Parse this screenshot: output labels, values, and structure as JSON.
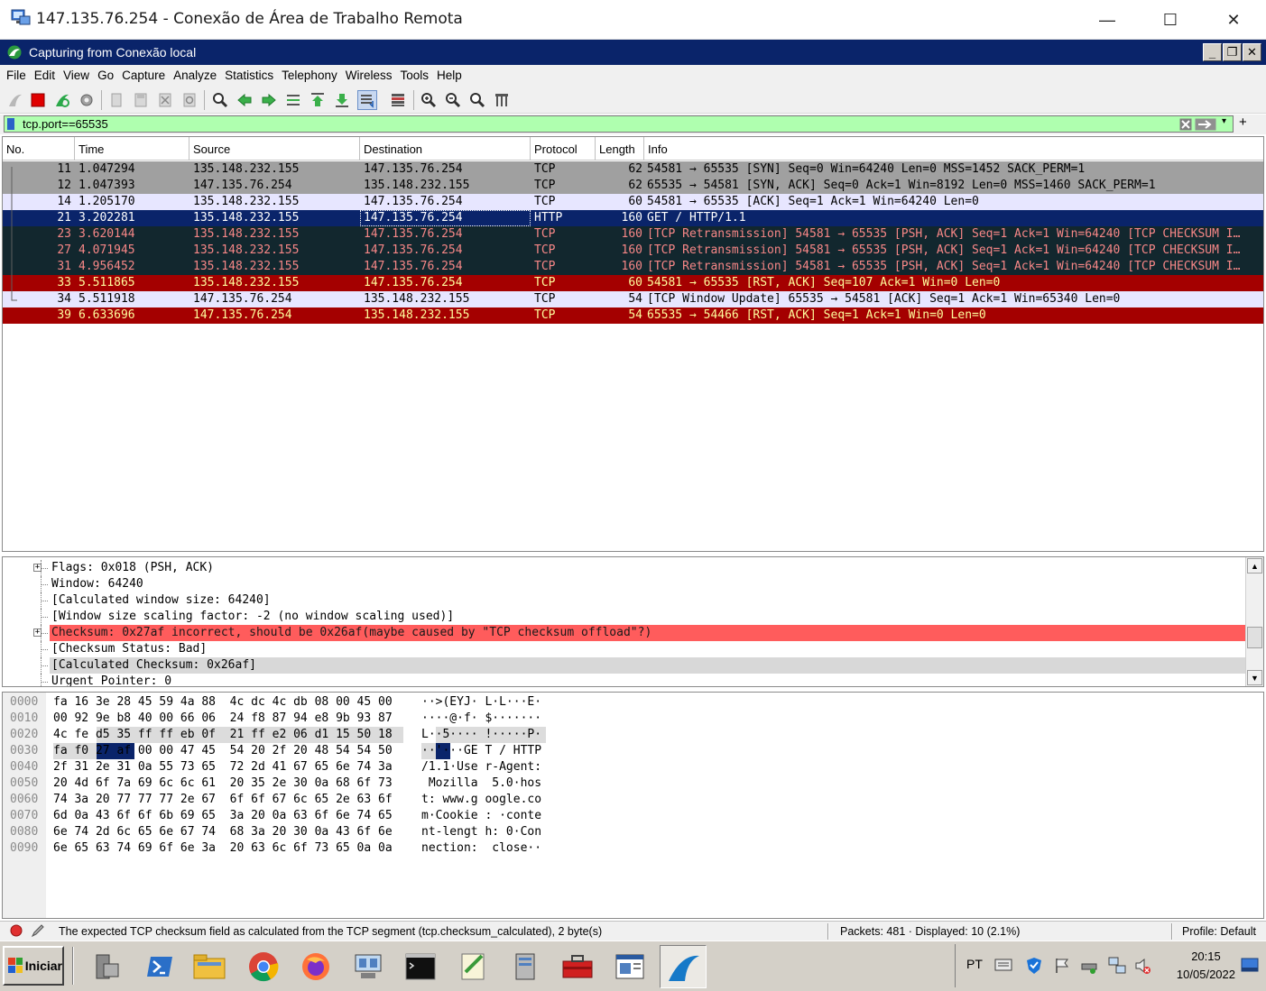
{
  "rdp": {
    "title": "147.135.76.254 - Conexão de Área de Trabalho Remota",
    "minimize": "—",
    "maximize": "☐",
    "close": "✕"
  },
  "wireshark": {
    "title": "Capturing from Conexão local"
  },
  "menu": [
    "File",
    "Edit",
    "View",
    "Go",
    "Capture",
    "Analyze",
    "Statistics",
    "Telephony",
    "Wireless",
    "Tools",
    "Help"
  ],
  "filter": {
    "value": "tcp.port==65535",
    "bg_color": "#afffaf"
  },
  "columns": [
    "No.",
    "Time",
    "Source",
    "Destination",
    "Protocol",
    "Length",
    "Info"
  ],
  "packets": [
    {
      "no": "11",
      "time": "1.047294",
      "src": "135.148.232.155",
      "dst": "147.135.76.254",
      "proto": "TCP",
      "len": "62",
      "info": "54581 → 65535 [SYN] Seq=0 Win=64240 Len=0 MSS=1452 SACK_PERM=1",
      "style": "syn"
    },
    {
      "no": "12",
      "time": "1.047393",
      "src": "147.135.76.254",
      "dst": "135.148.232.155",
      "proto": "TCP",
      "len": "62",
      "info": "65535 → 54581 [SYN, ACK] Seq=0 Ack=1 Win=8192 Len=0 MSS=1460 SACK_PERM=1",
      "style": "syn"
    },
    {
      "no": "14",
      "time": "1.205170",
      "src": "135.148.232.155",
      "dst": "147.135.76.254",
      "proto": "TCP",
      "len": "60",
      "info": "54581 → 65535 [ACK] Seq=1 Ack=1 Win=64240 Len=0",
      "style": "tcp"
    },
    {
      "no": "21",
      "time": "3.202281",
      "src": "135.148.232.155",
      "dst": "147.135.76.254",
      "proto": "HTTP",
      "len": "160",
      "info": "GET / HTTP/1.1",
      "style": "selected"
    },
    {
      "no": "23",
      "time": "3.620144",
      "src": "135.148.232.155",
      "dst": "147.135.76.254",
      "proto": "TCP",
      "len": "160",
      "info": "[TCP Retransmission] 54581 → 65535 [PSH, ACK] Seq=1 Ack=1 Win=64240 [TCP CHECKSUM I…",
      "style": "bad"
    },
    {
      "no": "27",
      "time": "4.071945",
      "src": "135.148.232.155",
      "dst": "147.135.76.254",
      "proto": "TCP",
      "len": "160",
      "info": "[TCP Retransmission] 54581 → 65535 [PSH, ACK] Seq=1 Ack=1 Win=64240 [TCP CHECKSUM I…",
      "style": "bad"
    },
    {
      "no": "31",
      "time": "4.956452",
      "src": "135.148.232.155",
      "dst": "147.135.76.254",
      "proto": "TCP",
      "len": "160",
      "info": "[TCP Retransmission] 54581 → 65535 [PSH, ACK] Seq=1 Ack=1 Win=64240 [TCP CHECKSUM I…",
      "style": "bad"
    },
    {
      "no": "33",
      "time": "5.511865",
      "src": "135.148.232.155",
      "dst": "147.135.76.254",
      "proto": "TCP",
      "len": "60",
      "info": "54581 → 65535 [RST, ACK] Seq=107 Ack=1 Win=0 Len=0",
      "style": "rst"
    },
    {
      "no": "34",
      "time": "5.511918",
      "src": "147.135.76.254",
      "dst": "135.148.232.155",
      "proto": "TCP",
      "len": "54",
      "info": "[TCP Window Update] 65535 → 54581 [ACK] Seq=1 Ack=1 Win=65340 Len=0",
      "style": "tcp"
    },
    {
      "no": "39",
      "time": "6.633696",
      "src": "147.135.76.254",
      "dst": "135.148.232.155",
      "proto": "TCP",
      "len": "54",
      "info": "65535 → 54466 [RST, ACK] Seq=1 Ack=1 Win=0 Len=0",
      "style": "rst"
    }
  ],
  "row_colors": {
    "syn": {
      "bg": "#a0a0a0",
      "fg": "#000000"
    },
    "tcp": {
      "bg": "#e7e6ff",
      "fg": "#000000"
    },
    "selected": {
      "bg": "#0a246a",
      "fg": "#ffffff"
    },
    "bad": {
      "bg": "#12272e",
      "fg": "#f78787"
    },
    "rst": {
      "bg": "#a40000",
      "fg": "#fffc9c"
    }
  },
  "details": [
    {
      "text": "Flags: 0x018 (PSH, ACK)",
      "expander": "+",
      "style": "normal"
    },
    {
      "text": "Window: 64240",
      "expander": "",
      "style": "normal"
    },
    {
      "text": "[Calculated window size: 64240]",
      "expander": "",
      "style": "normal"
    },
    {
      "text": "[Window size scaling factor: -2 (no window scaling used)]",
      "expander": "",
      "style": "normal"
    },
    {
      "text": "Checksum: 0x27af incorrect, should be 0x26af(maybe caused by \"TCP checksum offload\"?)",
      "expander": "+",
      "style": "error"
    },
    {
      "text": "[Checksum Status: Bad]",
      "expander": "",
      "style": "normal"
    },
    {
      "text": "[Calculated Checksum: 0x26af]",
      "expander": "",
      "style": "highlight"
    },
    {
      "text": "Urgent Pointer: 0",
      "expander": "",
      "style": "normal"
    }
  ],
  "hex": [
    {
      "offset": "0000",
      "bytes": "fa 16 3e 28 45 59 4a 88  4c dc 4c db 08 00 45 00",
      "ascii": "··>(EYJ· L·L···E·"
    },
    {
      "offset": "0010",
      "bytes": "00 92 9e b8 40 00 66 06  24 f8 87 94 e8 9b 93 87",
      "ascii": "····@·f· $·······"
    },
    {
      "offset": "0020",
      "bytes": "4c fe d5 35 ff ff eb 0f  21 ff e2 06 d1 15 50 18",
      "ascii": "L··5···· !·····P·"
    },
    {
      "offset": "0030",
      "bytes": "fa f0 27 af 00 00 47 45  54 20 2f 20 48 54 54 50",
      "ascii": "··'···GE T / HTTP"
    },
    {
      "offset": "0040",
      "bytes": "2f 31 2e 31 0a 55 73 65  72 2d 41 67 65 6e 74 3a",
      "ascii": "/1.1·Use r-Agent:"
    },
    {
      "offset": "0050",
      "bytes": "20 4d 6f 7a 69 6c 6c 61  20 35 2e 30 0a 68 6f 73",
      "ascii": " Mozilla  5.0·hos"
    },
    {
      "offset": "0060",
      "bytes": "74 3a 20 77 77 77 2e 67  6f 6f 67 6c 65 2e 63 6f",
      "ascii": "t: www.g oogle.co"
    },
    {
      "offset": "0070",
      "bytes": "6d 0a 43 6f 6f 6b 69 65  3a 20 0a 63 6f 6e 74 65",
      "ascii": "m·Cookie : ·conte"
    },
    {
      "offset": "0080",
      "bytes": "6e 74 2d 6c 65 6e 67 74  68 3a 20 30 0a 43 6f 6e",
      "ascii": "nt-lengt h: 0·Con"
    },
    {
      "offset": "0090",
      "bytes": "6e 65 63 74 69 6f 6e 3a  20 63 6c 6f 73 65 0a 0a",
      "ascii": "nection:  close··"
    }
  ],
  "status": {
    "message": "The expected TCP checksum field as calculated from the TCP segment (tcp.checksum_calculated), 2 byte(s)",
    "packets": "Packets: 481 · Displayed: 10 (2.1%)",
    "profile": "Profile: Default"
  },
  "taskbar": {
    "start": "Iniciar",
    "apps": [
      "server-manager-icon",
      "powershell-icon",
      "file-explorer-icon",
      "chrome-icon",
      "firefox-icon",
      "network-icon",
      "cmd-icon",
      "notepad-icon",
      "server-icon",
      "toolbox-icon",
      "document-icon",
      "wireshark-icon"
    ],
    "lang": "PT",
    "time": "20:15",
    "date": "10/05/2022"
  }
}
